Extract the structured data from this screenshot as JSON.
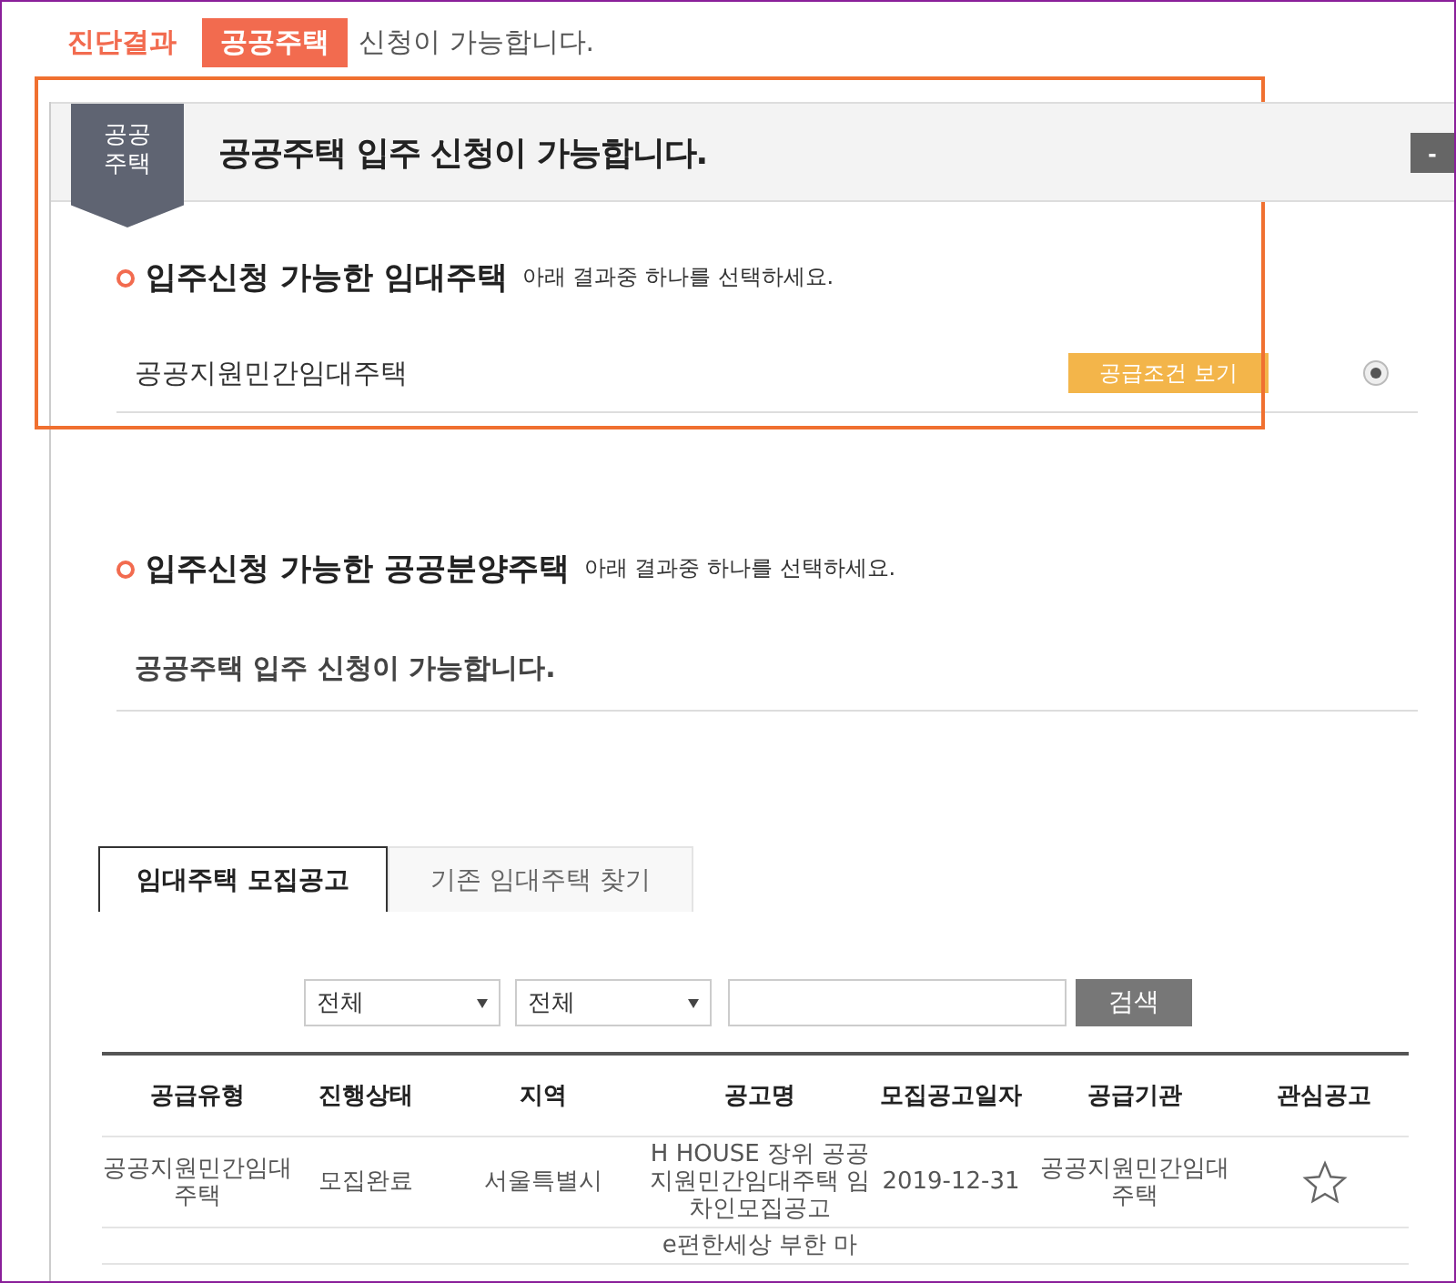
{
  "result_line": {
    "label": "진단결과",
    "badge": "공공주택",
    "text": "신청이 가능합니다."
  },
  "panel": {
    "badge_lines": [
      "공공",
      "주택"
    ],
    "title": "공공주택 입주 신청이 가능합니다.",
    "collapse_button": "-"
  },
  "sections": [
    {
      "heading": "입주신청 가능한 임대주택",
      "hint": "아래 결과중 하나를 선택하세요.",
      "items": [
        {
          "kind": "option",
          "label": "공공지원민간임대주택",
          "button": "공급조건 보기",
          "selected": true
        }
      ]
    },
    {
      "heading": "입주신청 가능한 공공분양주택",
      "hint": "아래 결과중 하나를 선택하세요.",
      "items": [
        {
          "kind": "message",
          "label": "공공주택 입주 신청이 가능합니다."
        }
      ]
    }
  ],
  "tabs": [
    {
      "label": "임대주택 모집공고",
      "selected": true
    },
    {
      "label": "기존 임대주택 찾기",
      "selected": false
    }
  ],
  "filters": {
    "selects": [
      "전체",
      "전체"
    ],
    "search_button": "검색"
  },
  "table": {
    "columns": [
      "공급유형",
      "진행상태",
      "지역",
      "공고명",
      "모집공고일자",
      "공급기관",
      "관심공고"
    ],
    "rows": [
      {
        "type": "공공지원민간임대주택",
        "status": "모집완료",
        "region": "서울특별시",
        "title": "H HOUSE 장위 공공지원민간임대주택 임차인모집공고",
        "date": "2019-12-31",
        "agency": "공공지원민간임대주택",
        "favorite": false
      },
      {
        "title": "e편한세상 부한 마"
      }
    ]
  }
}
